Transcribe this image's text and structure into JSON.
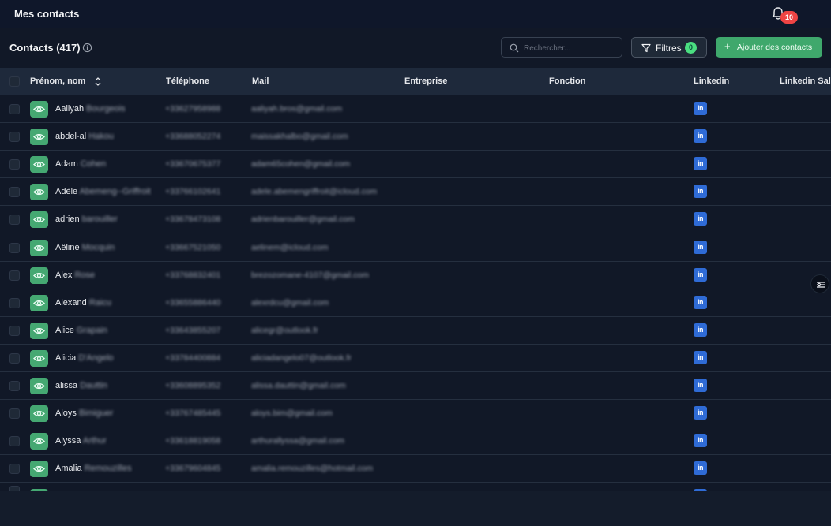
{
  "app": {
    "title": "Mes contacts"
  },
  "notifications": {
    "count": "10",
    "icon": "bell-icon"
  },
  "toolbar": {
    "title": "Contacts (417)",
    "search_placeholder": "Rechercher...",
    "filter_label": "Filtres",
    "filter_count": "0",
    "add_label": "Ajouter des contacts"
  },
  "table": {
    "columns": [
      "Prénom, nom",
      "Téléphone",
      "Mail",
      "Entreprise",
      "Fonction",
      "Linkedin",
      "Linkedin Sale"
    ],
    "rows": [
      {
        "first": "Aaliyah",
        "last": "Bourgeois",
        "phone": "+33627958988",
        "mail": "aaliyah.bros@gmail.com",
        "linkedin": "in"
      },
      {
        "first": "abdel-al",
        "last": "Hakou",
        "phone": "+33688052274",
        "mail": "maissakhalbo@gmail.com",
        "linkedin": "in"
      },
      {
        "first": "Adam",
        "last": "Cohen",
        "phone": "+33670675377",
        "mail": "adam65cohen@gmail.com",
        "linkedin": "in"
      },
      {
        "first": "Adèle",
        "last": "Abemeng--Griffroit",
        "phone": "+33766102641",
        "mail": "adele.abemengriffroit@icloud.com",
        "linkedin": "in"
      },
      {
        "first": "adrien",
        "last": "barouiller",
        "phone": "+33678473108",
        "mail": "adrienbarouiller@gmail.com",
        "linkedin": "in"
      },
      {
        "first": "Aëline",
        "last": "Mocquin",
        "phone": "+33667521050",
        "mail": "aelinem@icloud.com",
        "linkedin": "in"
      },
      {
        "first": "Alex",
        "last": "Rose",
        "phone": "+33768832401",
        "mail": "brezozomane-4107@gmail.com",
        "linkedin": "in"
      },
      {
        "first": "Alexand",
        "last": "Raicu",
        "phone": "+33655886440",
        "mail": "alexrdcu@gmail.com",
        "linkedin": "in"
      },
      {
        "first": "Alice",
        "last": "Grapain",
        "phone": "+33643855207",
        "mail": "alicegr@outlook.fr",
        "linkedin": "in"
      },
      {
        "first": "Alicia",
        "last": "D'Angelo",
        "phone": "+33784400884",
        "mail": "aliciadangelo07@outlook.fr",
        "linkedin": "in"
      },
      {
        "first": "alissa",
        "last": "Dauttin",
        "phone": "+33608895352",
        "mail": "alissa.dauttin@gmail.com",
        "linkedin": "in"
      },
      {
        "first": "Aloys",
        "last": "Bimiguer",
        "phone": "+33767485445",
        "mail": "aloys.bim@gmail.com",
        "linkedin": "in"
      },
      {
        "first": "Alyssa",
        "last": "Arthur",
        "phone": "+33618819058",
        "mail": "arthurallyssa@gmail.com",
        "linkedin": "in"
      },
      {
        "first": "Amalia",
        "last": "Remouzilles",
        "phone": "+33679604845",
        "mail": "amalia.remouzilles@hotmail.com",
        "linkedin": "in"
      }
    ]
  },
  "colors": {
    "accent_green": "#45a872",
    "linkedin_blue": "#2f6bd6",
    "badge_red": "#ef4444"
  }
}
